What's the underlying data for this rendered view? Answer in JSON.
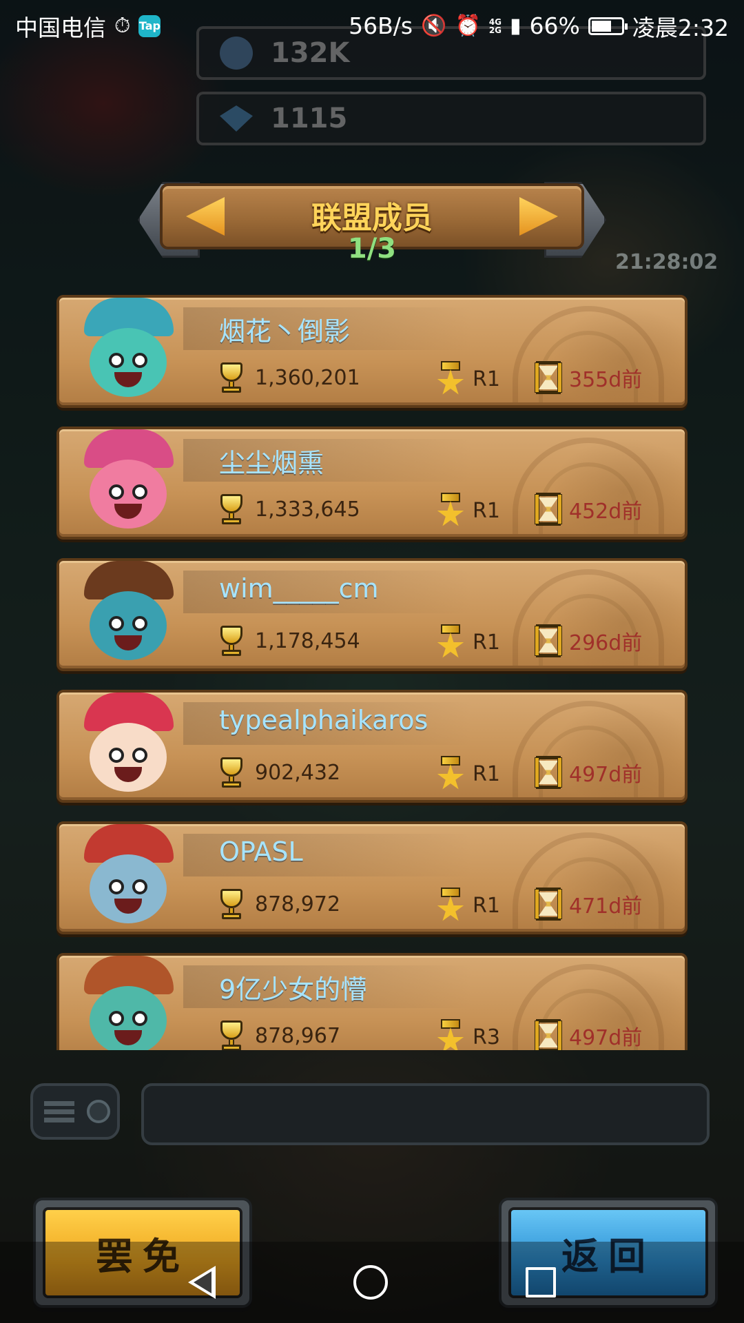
{
  "status_bar": {
    "carrier": "中国电信",
    "app_badge": "Tap",
    "net_speed": "56B/s",
    "net_type_top": "4G",
    "net_type_bottom": "2G",
    "battery": "66%",
    "time": "凌晨2:32"
  },
  "resources": {
    "gold": "132K",
    "gems": "1115"
  },
  "timer": "21:28:02",
  "header": {
    "title": "联盟成员",
    "page": "1/3"
  },
  "members": [
    {
      "name": "烟花丶倒影",
      "trophies": "1,360,201",
      "rank": "R1",
      "last_seen": "355d前",
      "avatar_color": "#49c4b4",
      "hat_color": "#3aa6b8"
    },
    {
      "name": "尘尘烟熏",
      "trophies": "1,333,645",
      "rank": "R1",
      "last_seen": "452d前",
      "avatar_color": "#f07ca0",
      "hat_color": "#d94d86"
    },
    {
      "name": "wim_____cm",
      "trophies": "1,178,454",
      "rank": "R1",
      "last_seen": "296d前",
      "avatar_color": "#3aa0b0",
      "hat_color": "#6b3a1e"
    },
    {
      "name": "typealphaikaros",
      "trophies": "902,432",
      "rank": "R1",
      "last_seen": "497d前",
      "avatar_color": "#f8dcc8",
      "hat_color": "#d93650"
    },
    {
      "name": "OPASL",
      "trophies": "878,972",
      "rank": "R1",
      "last_seen": "471d前",
      "avatar_color": "#8ab8d0",
      "hat_color": "#c23a30"
    },
    {
      "name": "9亿少女的懵",
      "trophies": "878,967",
      "rank": "R3",
      "last_seen": "497d前",
      "avatar_color": "#4fb8a8",
      "hat_color": "#b0552a"
    }
  ],
  "buttons": {
    "dismiss": "罢免",
    "back": "返回"
  }
}
